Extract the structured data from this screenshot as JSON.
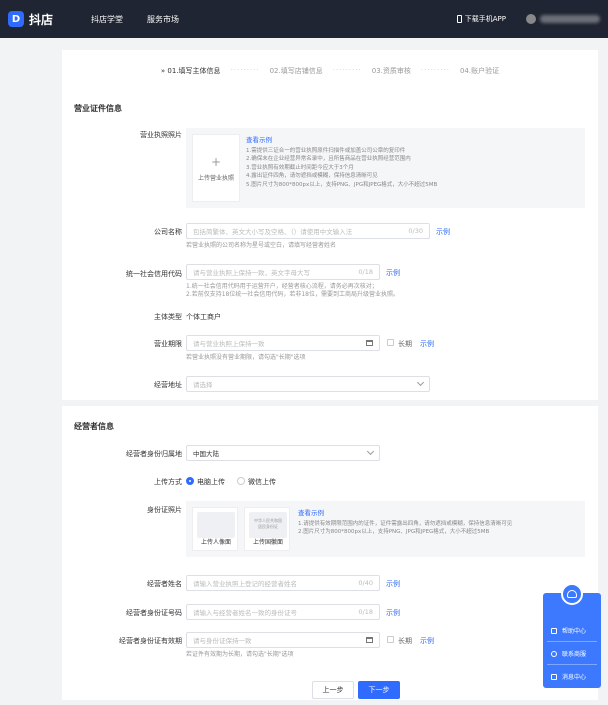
{
  "header": {
    "logo_text": "抖店",
    "nav": [
      "抖店学堂",
      "服务市场"
    ],
    "download_app": "下载手机APP"
  },
  "steps": [
    "01.填写主体信息",
    "02.填写店铺信息",
    "03.资质审核",
    "04.账户验证"
  ],
  "license_section": {
    "title": "营业证件信息",
    "photo_label": "营业执照照片",
    "upload_text": "上传营业执照",
    "upload_plus": "+",
    "example_link": "查看示例",
    "tips": [
      "1.需提供三证合一的营业执照原件扫描件或加盖公司公章的复印件",
      "2.确保未在企业经营异常名录中，且所售商品在营业执照经营范围内",
      "3.营业执照有效期截止时间距今应大于3个月",
      "4.露出证件四角，请勿遮挡或模糊，保持信息清晰可见",
      "5.图片尺寸为800*800px以上，支持PNG、JPG和JPEG格式，大小不超过5MB"
    ],
    "company_name": {
      "label": "公司名称",
      "placeholder": "包括简繁体、英文大小写及空格、（）请使用中文输入法",
      "count": "0/30",
      "example": "示例",
      "help": "若营业执照的公司名称为星号或空白，请填写经营者姓名"
    },
    "credit_code": {
      "label": "统一社会信用代码",
      "placeholder": "请与营业执照上保持一致，英文字母大写",
      "count": "0/18",
      "example": "示例",
      "help1": "1.统一社会信用代码用于运营开户，经营者核心流程，请务必再次核对；",
      "help2": "2.若前仅支持18位统一社会信用代码，若非18位，需要到工商局升级营业执照。"
    },
    "entity_type": {
      "label": "主体类型",
      "value": "个体工商户"
    },
    "period": {
      "label": "营业期限",
      "placeholder": "请与营业执照上保持一致",
      "long_term": "长期",
      "example": "示例",
      "help": "若营业执照没有营业期限，请勾选\"长期\"选项"
    },
    "address": {
      "label": "经营地址",
      "placeholder": "请选择"
    }
  },
  "operator_section": {
    "title": "经营者信息",
    "region": {
      "label": "经营者身份归属地",
      "value": "中国大陆"
    },
    "upload_method": {
      "label": "上传方式",
      "options": [
        "电脑上传",
        "微信上传"
      ]
    },
    "id_photo": {
      "label": "身份证照片",
      "front": "上传人像面",
      "back": "上传国徽面",
      "example_link": "查看示例",
      "back_card_text": "中华人民共和国\n居民身份证",
      "tips": [
        "1.请提供有效期限范围内的证件，证件需露出四角，请勿遮挡或模糊，保持信息清晰可见",
        "2.图片尺寸为800*800px以上，支持PNG、JPG和JPEG格式，大小不超过5MB"
      ]
    },
    "name": {
      "label": "经营者姓名",
      "placeholder": "请输入营业执照上登记的经营者姓名",
      "count": "0/40",
      "example": "示例"
    },
    "id_number": {
      "label": "经营者身份证号码",
      "placeholder": "请输入与经营者姓名一致的身份证号",
      "count": "0/18",
      "example": "示例"
    },
    "id_validity": {
      "label": "经营者身份证有效期",
      "placeholder": "请与身份证保持一致",
      "long_term": "长期",
      "example": "示例",
      "help": "若证件有效期为长期，请勾选\"长期\"选项"
    }
  },
  "footer": {
    "prev": "上一步",
    "next": "下一步"
  },
  "floating": {
    "items": [
      "帮助中心",
      "联系商服",
      "消息中心"
    ]
  },
  "colors": {
    "primary": "#2f6bff",
    "topbar": "#1f2532"
  }
}
